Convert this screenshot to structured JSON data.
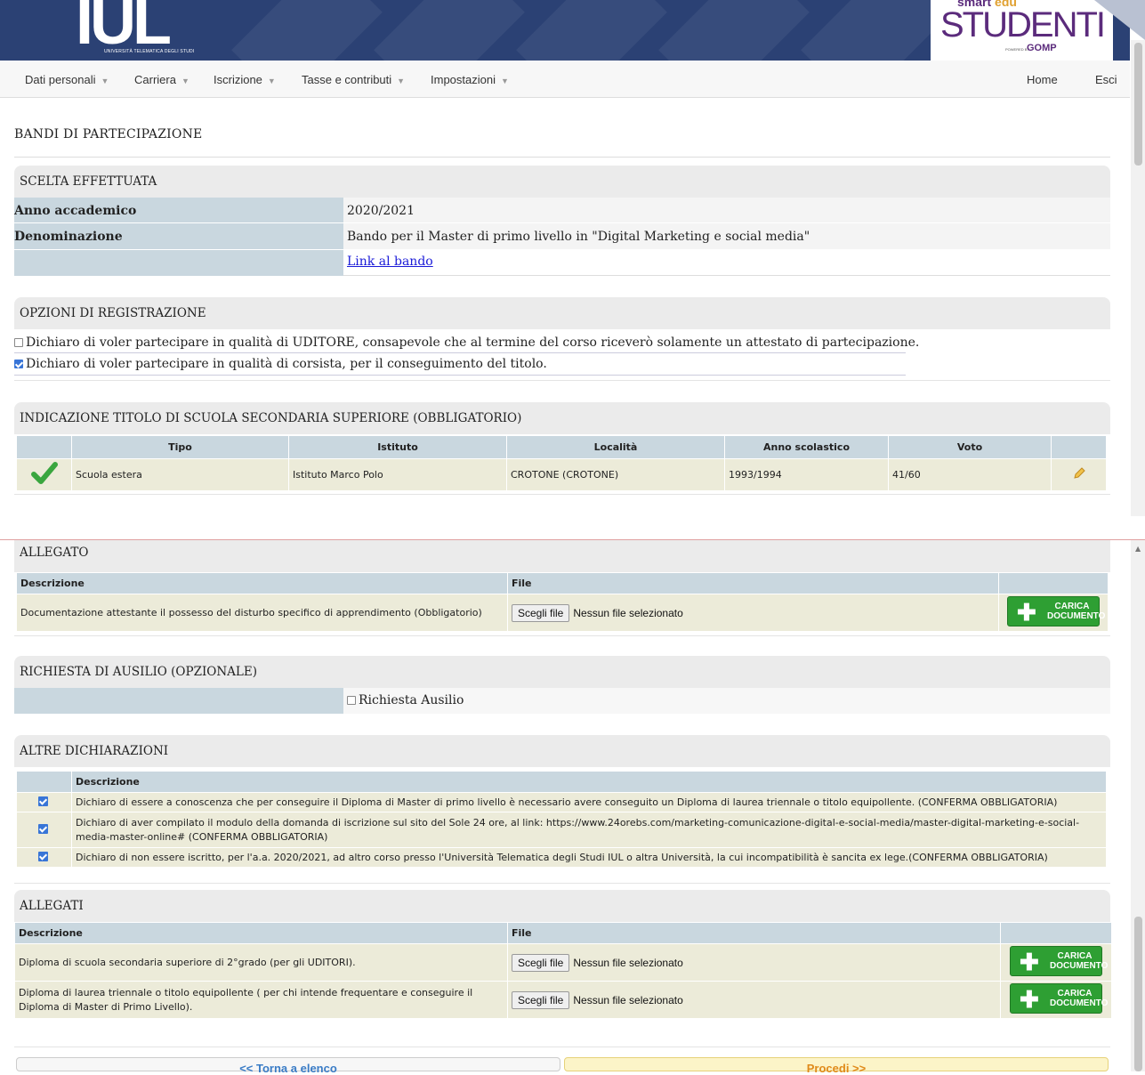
{
  "header": {
    "logo_text": "IUL",
    "logo_subtitle": "UNIVERSITÀ TELEMATICA DEGLI STUDI",
    "brand_top_a": "smart",
    "brand_top_b": "edu",
    "brand_word": "STUDENTI",
    "brand_powered": "POWERED BY",
    "brand_gomp": "GOMP"
  },
  "nav": {
    "items": [
      "Dati personali",
      "Carriera",
      "Iscrizione",
      "Tasse e contributi",
      "Impostazioni"
    ],
    "home": "Home",
    "exit": "Esci"
  },
  "page": {
    "title": "BANDI DI PARTECIPAZIONE"
  },
  "scelta": {
    "heading": "SCELTA EFFETTUATA",
    "anno_label": "Anno accademico",
    "anno_value": "2020/2021",
    "denominazione_label": "Denominazione",
    "denominazione_value": "Bando per il Master di primo livello in \"Digital Marketing e social media\"",
    "link": "Link al bando"
  },
  "opzioni": {
    "heading": "OPZIONI DI REGISTRAZIONE",
    "option1": "Dichiaro di voler partecipare in qualità di UDITORE, consapevole che al termine del corso riceverò solamente un attestato di partecipazione.",
    "option1_checked": false,
    "option2": "Dichiaro di voler partecipare in qualità di corsista, per il conseguimento del titolo.",
    "option2_checked": true
  },
  "titolo": {
    "heading": "INDICAZIONE TITOLO DI SCUOLA SECONDARIA SUPERIORE (OBBLIGATORIO)",
    "columns": [
      "Tipo",
      "Istituto",
      "Località",
      "Anno scolastico",
      "Voto"
    ],
    "row": [
      "Scuola estera",
      "Istituto Marco Polo",
      "CROTONE (CROTONE)",
      "1993/1994",
      "41/60"
    ]
  },
  "allegato": {
    "heading": "ALLEGATO",
    "col_desc": "Descrizione",
    "col_file": "File",
    "row_desc": "Documentazione attestante il possesso del disturbo specifico di apprendimento (Obbligatorio)",
    "choose_file": "Scegli file",
    "no_file": "Nessun file selezionato",
    "upload_line1": "CARICA",
    "upload_line2": "DOCUMENTO"
  },
  "ausilio": {
    "heading": "RICHIESTA DI AUSILIO (OPZIONALE)",
    "checkbox_label": "Richiesta Ausilio",
    "checked": false
  },
  "dichiarazioni": {
    "heading": "ALTRE DICHIARAZIONI",
    "col_desc": "Descrizione",
    "rows": [
      "Dichiaro di essere a conoscenza che per conseguire il Diploma di Master di primo livello è necessario avere conseguito un Diploma di laurea triennale o titolo equipollente. (CONFERMA OBBLIGATORIA)",
      "Dichiaro di aver compilato il modulo della domanda di iscrizione sul sito del Sole 24 ore, al link: https://www.24orebs.com/marketing-comunicazione-digital-e-social-media/master-digital-marketing-e-social-media-master-online# (CONFERMA OBBLIGATORIA)",
      "Dichiaro di non essere iscritto, per l'a.a. 2020/2021, ad altro corso presso l'Università Telematica degli Studi IUL o altra Università, la cui incompatibilità è sancita ex lege.(CONFERMA OBBLIGATORIA)"
    ]
  },
  "allegati": {
    "heading": "ALLEGATI",
    "col_desc": "Descrizione",
    "col_file": "File",
    "rows": [
      "Diploma di scuola secondaria superiore di 2°grado (per gli UDITORI).",
      "Diploma di laurea triennale o titolo equipollente ( per chi intende frequentare e conseguire il Diploma di Master di Primo Livello)."
    ]
  },
  "footer": {
    "back": "<< Torna a elenco",
    "next": "Procedi >>"
  },
  "colors": {
    "header": "#2b4174",
    "label_bg": "#c9d7df",
    "row_bg": "#ecebd9",
    "button_green": "#2e9f33"
  }
}
